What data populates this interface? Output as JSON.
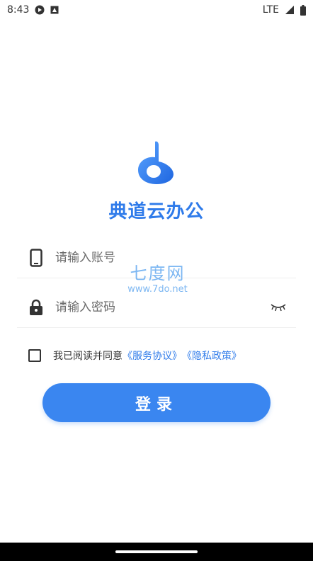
{
  "status_bar": {
    "time": "8:43",
    "network": "LTE",
    "icons": [
      "play-protect-icon",
      "autofill-icon",
      "signal-icon",
      "battery-icon"
    ]
  },
  "app": {
    "title": "典道云办公",
    "brand_color": "#2f7bea"
  },
  "form": {
    "account_placeholder": "请输入账号",
    "password_placeholder": "请输入密码"
  },
  "watermark": {
    "text": "七度网",
    "url": "www.7do.net"
  },
  "agreement": {
    "text": "我已阅读并同意",
    "service_link": "《服务协议》",
    "privacy_link": "《隐私政策》",
    "checked": false
  },
  "login_button": {
    "label": "登录",
    "color": "#3a86f0"
  }
}
